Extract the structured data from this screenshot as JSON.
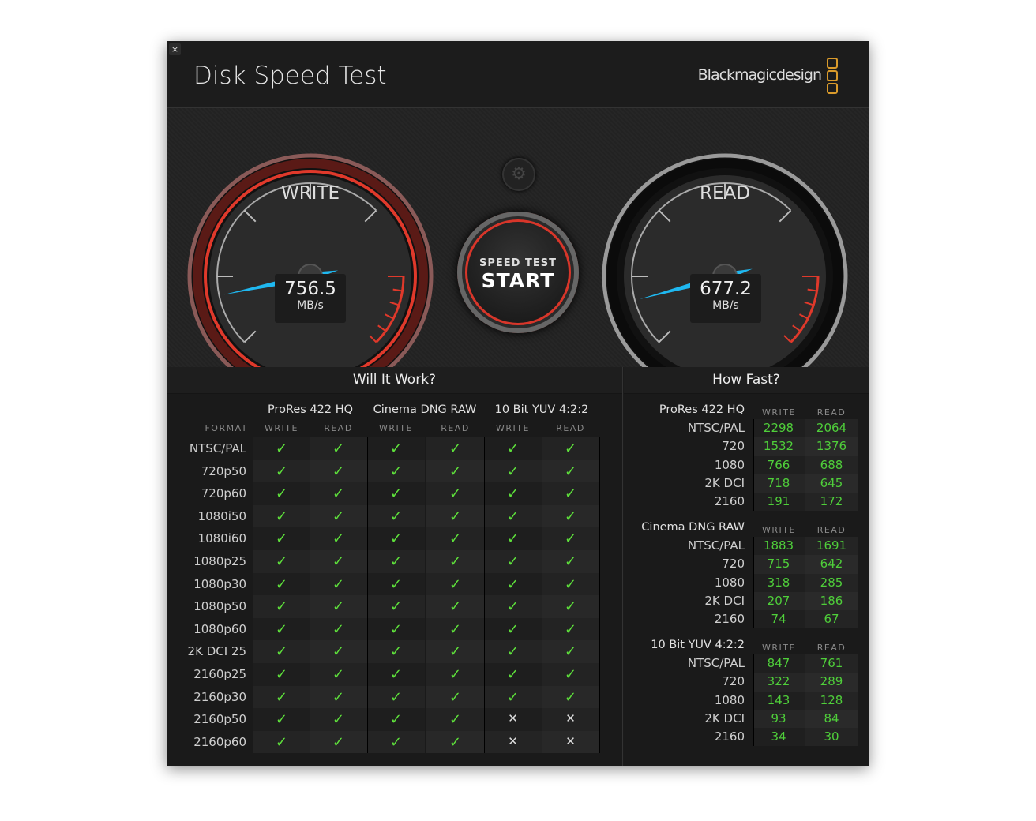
{
  "window": {
    "close_label": "×",
    "title": "Disk Speed Test",
    "brand": "Blackmagicdesign"
  },
  "colors": {
    "accent_red": "#e0392b",
    "needle_blue": "#1fb8f0",
    "check_green": "#5ee13b",
    "value_green": "#4fcf3a",
    "logo_orange": "#d99a2b"
  },
  "gauges": {
    "write": {
      "label": "WRITE",
      "value": "756.5",
      "unit": "MB/s"
    },
    "read": {
      "label": "READ",
      "value": "677.2",
      "unit": "MB/s"
    }
  },
  "start_button": {
    "line1": "SPEED TEST",
    "line2": "START",
    "settings_icon": "gear-icon"
  },
  "will_it_work": {
    "title": "Will It Work?",
    "format_label": "FORMAT",
    "groups": [
      "ProRes 422 HQ",
      "Cinema DNG RAW",
      "10 Bit YUV 4:2:2"
    ],
    "subs": [
      "WRITE",
      "READ",
      "WRITE",
      "READ",
      "WRITE",
      "READ"
    ],
    "rows": [
      {
        "format": "NTSC/PAL",
        "cells": [
          1,
          1,
          1,
          1,
          1,
          1
        ]
      },
      {
        "format": "720p50",
        "cells": [
          1,
          1,
          1,
          1,
          1,
          1
        ]
      },
      {
        "format": "720p60",
        "cells": [
          1,
          1,
          1,
          1,
          1,
          1
        ]
      },
      {
        "format": "1080i50",
        "cells": [
          1,
          1,
          1,
          1,
          1,
          1
        ]
      },
      {
        "format": "1080i60",
        "cells": [
          1,
          1,
          1,
          1,
          1,
          1
        ]
      },
      {
        "format": "1080p25",
        "cells": [
          1,
          1,
          1,
          1,
          1,
          1
        ]
      },
      {
        "format": "1080p30",
        "cells": [
          1,
          1,
          1,
          1,
          1,
          1
        ]
      },
      {
        "format": "1080p50",
        "cells": [
          1,
          1,
          1,
          1,
          1,
          1
        ]
      },
      {
        "format": "1080p60",
        "cells": [
          1,
          1,
          1,
          1,
          1,
          1
        ]
      },
      {
        "format": "2K DCI 25",
        "cells": [
          1,
          1,
          1,
          1,
          1,
          1
        ]
      },
      {
        "format": "2160p25",
        "cells": [
          1,
          1,
          1,
          1,
          1,
          1
        ]
      },
      {
        "format": "2160p30",
        "cells": [
          1,
          1,
          1,
          1,
          1,
          1
        ]
      },
      {
        "format": "2160p50",
        "cells": [
          1,
          1,
          1,
          1,
          0,
          0
        ]
      },
      {
        "format": "2160p60",
        "cells": [
          1,
          1,
          1,
          1,
          0,
          0
        ]
      }
    ],
    "check_glyph": "✓",
    "cross_glyph": "✕"
  },
  "how_fast": {
    "title": "How Fast?",
    "write_label": "WRITE",
    "read_label": "READ",
    "sections": [
      {
        "name": "ProRes 422 HQ",
        "rows": [
          [
            "NTSC/PAL",
            "2298",
            "2064"
          ],
          [
            "720",
            "1532",
            "1376"
          ],
          [
            "1080",
            "766",
            "688"
          ],
          [
            "2K DCI",
            "718",
            "645"
          ],
          [
            "2160",
            "191",
            "172"
          ]
        ]
      },
      {
        "name": "Cinema DNG RAW",
        "rows": [
          [
            "NTSC/PAL",
            "1883",
            "1691"
          ],
          [
            "720",
            "715",
            "642"
          ],
          [
            "1080",
            "318",
            "285"
          ],
          [
            "2K DCI",
            "207",
            "186"
          ],
          [
            "2160",
            "74",
            "67"
          ]
        ]
      },
      {
        "name": "10 Bit YUV 4:2:2",
        "rows": [
          [
            "NTSC/PAL",
            "847",
            "761"
          ],
          [
            "720",
            "322",
            "289"
          ],
          [
            "1080",
            "143",
            "128"
          ],
          [
            "2K DCI",
            "93",
            "84"
          ],
          [
            "2160",
            "34",
            "30"
          ]
        ]
      }
    ]
  }
}
